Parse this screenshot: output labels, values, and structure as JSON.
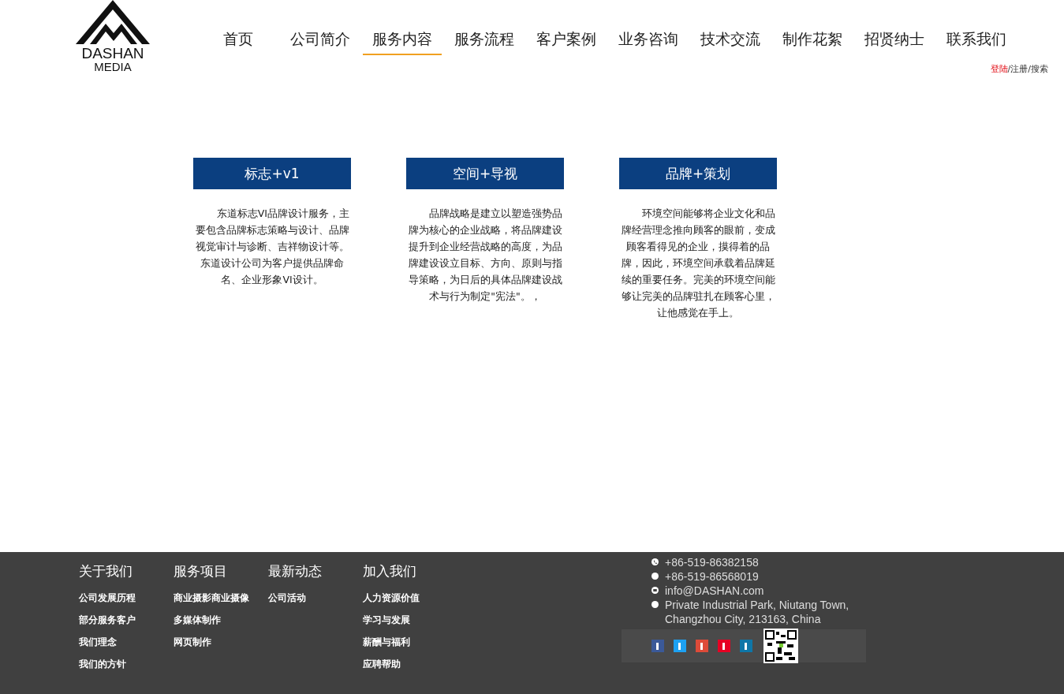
{
  "logo": {
    "line_1": "DASHAN",
    "line_2": "MEDIA"
  },
  "nav": [
    {
      "label": "首页",
      "selected": false
    },
    {
      "label": "公司简介",
      "selected": false
    },
    {
      "label": "服务内容",
      "selected": true
    },
    {
      "label": "服务流程",
      "selected": false
    },
    {
      "label": "客户案例",
      "selected": false
    },
    {
      "label": "业务咨询",
      "selected": false
    },
    {
      "label": "技术交流",
      "selected": false
    },
    {
      "label": "制作花絮",
      "selected": false
    },
    {
      "label": "招贤纳士",
      "selected": false
    },
    {
      "label": "联系我们",
      "selected": false
    }
  ],
  "account_links": {
    "login": "登陆",
    "rest": "/注册/搜索"
  },
  "services": [
    {
      "title": "标志+v1",
      "text": "东道标志VI品牌设计服务，主要包含品牌标志策略与设计、品牌视觉审计与诊断、吉祥物设计等。东道设计公司为客户提供品牌命名、企业形象VI设计。"
    },
    {
      "title": "空间+导视",
      "text": "品牌战略是建立以塑造强势品牌为核心的企业战略，将品牌建设提升到企业经营战略的高度，为品牌建设设立目标、方向、原则与指导策略，为日后的具体品牌建设战术与行为制定\"宪法\"。，"
    },
    {
      "title": "品牌+策划",
      "text": "环境空间能够将企业文化和品牌经营理念推向顾客的眼前，变成顾客看得见的企业，摸得着的品牌，因此，环境空间承载着品牌延续的重要任务。完美的环境空间能够让完美的品牌驻扎在顾客心里，让他感觉在手上。"
    }
  ],
  "footer": {
    "columns": [
      {
        "heading": "关于我们",
        "links": [
          "公司发展历程",
          "部分服务客户",
          "我们理念",
          "我们的方针"
        ]
      },
      {
        "heading": "服务项目",
        "links": [
          "商业摄影商业摄像",
          "多媒体制作",
          "网页制作"
        ]
      },
      {
        "heading": "最新动态",
        "links": [
          "公司活动"
        ]
      },
      {
        "heading": "加入我们",
        "links": [
          "人力资源价值",
          "学习与发展",
          "薪酬与福利",
          "应聘帮助"
        ]
      }
    ],
    "contacts": [
      {
        "kind": "phone",
        "text": "+86-519-86382158"
      },
      {
        "kind": "dot",
        "text": "+86-519-86568019"
      },
      {
        "kind": "mail",
        "text": "info@DASHAN.com"
      },
      {
        "kind": "dot",
        "text": "Private Industrial Park, Niutang Town, Changzhou City, 213163, China"
      }
    ],
    "social": [
      {
        "color": "#3b5998"
      },
      {
        "color": "#1da1f2"
      },
      {
        "color": "#dd4b39"
      },
      {
        "color": "#e60023"
      },
      {
        "color": "#0e76a8"
      }
    ]
  }
}
